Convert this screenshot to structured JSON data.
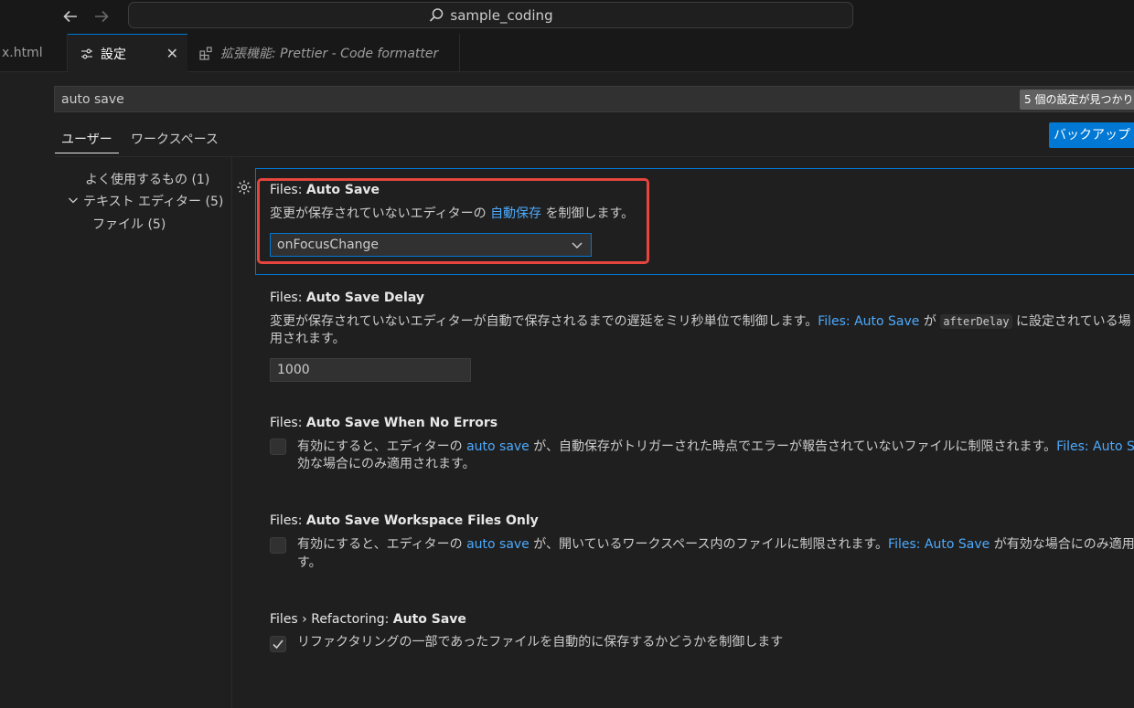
{
  "titlebar": {
    "back_icon": "arrow-left-icon",
    "forward_icon": "arrow-right-icon",
    "search_icon": "search-icon",
    "project_name": "sample_coding"
  },
  "tabs": [
    {
      "label": "x.html"
    },
    {
      "label": "設定",
      "icon": "settings-sliders-icon",
      "close": "✕"
    },
    {
      "label": "拡張機能: Prettier - Code formatter",
      "icon": "extensions-icon"
    }
  ],
  "search": {
    "value": "auto save",
    "result_count": "5 個の設定が見つかりま"
  },
  "scope": {
    "user": "ユーザー",
    "workspace": "ワークスペース",
    "backup_button": "バックアップ"
  },
  "toc": {
    "items": [
      {
        "label": "よく使用するもの (1)"
      },
      {
        "label": "テキスト エディター (5)",
        "expanded": true
      },
      {
        "label": "ファイル (5)"
      }
    ]
  },
  "settings": [
    {
      "category": "Files: ",
      "name": "Auto Save",
      "desc_before": "変更が保存されていないエディターの ",
      "desc_link": "自動保存",
      "desc_after": " を制御します。",
      "value": "onFocusChange"
    },
    {
      "category": "Files: ",
      "name": "Auto Save Delay",
      "desc_before": "変更が保存されていないエディターが自動で保存されるまでの遅延をミリ秒単位で制御します。",
      "desc_link": "Files: Auto Save",
      "desc_mid": " が ",
      "desc_code": "afterDelay",
      "desc_after": " に設定されている場",
      "desc_line2": "用されます。",
      "value": "1000"
    },
    {
      "category": "Files: ",
      "name": "Auto Save When No Errors",
      "desc_before": "有効にすると、エディターの ",
      "desc_link": "auto save",
      "desc_mid": " が、自動保存がトリガーされた時点でエラーが報告されていないファイルに制限されます。",
      "desc_link2": "Files: Auto S",
      "desc_line2": "効な場合にのみ適用されます。",
      "checked": false
    },
    {
      "category": "Files: ",
      "name": "Auto Save Workspace Files Only",
      "desc_before": "有効にすると、エディターの ",
      "desc_link": "auto save",
      "desc_mid": " が、開いているワークスペース内のファイルに制限されます。",
      "desc_link2": "Files: Auto Save",
      "desc_after": " が有効な場合にのみ適用",
      "desc_line2": "す。",
      "checked": false
    },
    {
      "category": "Files › Refactoring: ",
      "name": "Auto Save",
      "desc_before": "リファクタリングの一部であったファイルを自動的に保存するかどうかを制御します",
      "checked": true
    }
  ],
  "colors": {
    "accent": "#0078d4",
    "link": "#4daafc",
    "highlight": "#e5453d"
  }
}
